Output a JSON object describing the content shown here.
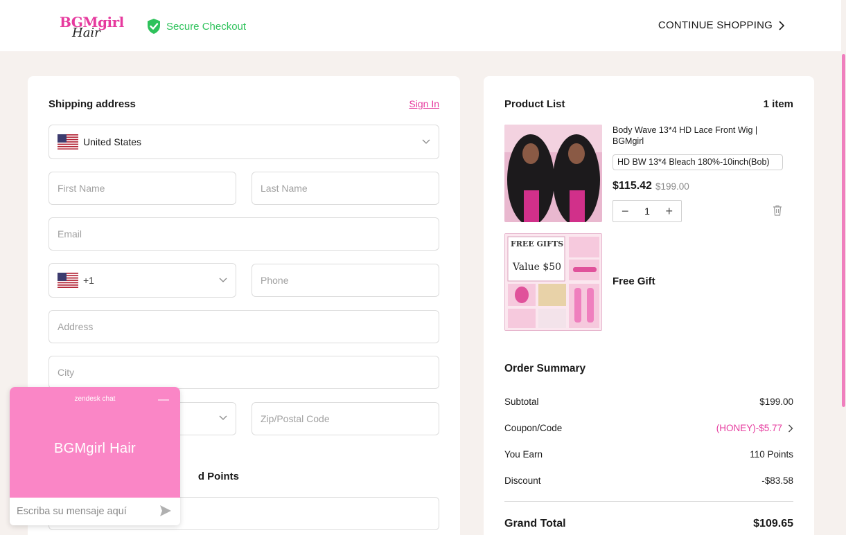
{
  "header": {
    "logo_text_top": "BGMgirl",
    "logo_text_bottom": "Hair",
    "secure_label": "Secure Checkout",
    "continue_label": "CONTINUE SHOPPING"
  },
  "shipping": {
    "title": "Shipping address",
    "sign_in": "Sign In",
    "country": "United States",
    "first_name_placeholder": "First Name",
    "last_name_placeholder": "Last Name",
    "email_placeholder": "Email",
    "phone_code": "+1",
    "phone_placeholder": "Phone",
    "address_placeholder": "Address",
    "city_placeholder": "City",
    "zip_placeholder": "Zip/Postal Code",
    "points_heading_partial": "d Points"
  },
  "products": {
    "title": "Product List",
    "count": "1 item",
    "item": {
      "name": "Body Wave 13*4 HD Lace Front Wig | BGMgirl",
      "variant": "HD BW 13*4 Bleach 180%-10inch(Bob)",
      "price": "$115.42",
      "old_price": "$199.00",
      "quantity": "1"
    },
    "gift": {
      "label": "Free Gift",
      "image_title": "FREE GIFTS",
      "image_value": "Value $50"
    }
  },
  "summary": {
    "title": "Order Summary",
    "rows": [
      {
        "label": "Subtotal",
        "value": "$199.00"
      },
      {
        "label": "Coupon/Code",
        "value": "(HONEY)-$5.77"
      },
      {
        "label": "You Earn",
        "value": "110 Points"
      },
      {
        "label": "Discount",
        "value": "-$83.58"
      }
    ],
    "grand_total_label": "Grand Total",
    "grand_total_value": "$109.65"
  },
  "chat": {
    "brand": "zendesk chat",
    "title": "BGMgirl Hair",
    "input_placeholder": "Escriba su mensaje aquí"
  },
  "colors": {
    "accent": "#e63a9e",
    "secure_green": "#2ec25b",
    "chat_pink": "#fa86c6",
    "background": "#f6f1ee"
  }
}
